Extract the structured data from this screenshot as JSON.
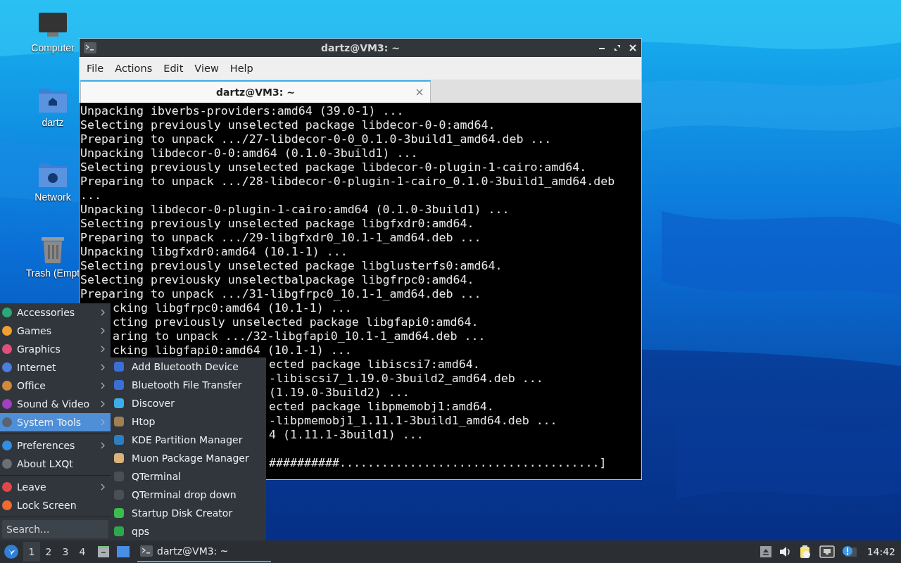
{
  "desktop_icons": [
    {
      "label": "Computer"
    },
    {
      "label": "dartz"
    },
    {
      "label": "Network"
    },
    {
      "label": "Trash (Empt"
    }
  ],
  "window": {
    "title": "dartz@VM3: ~",
    "menu": [
      "File",
      "Actions",
      "Edit",
      "View",
      "Help"
    ],
    "tabs": [
      {
        "label": "dartz@VM3: ~",
        "selected": true
      }
    ],
    "terminal_lines": [
      {
        "kind": "full",
        "text": "Unpacking ibverbs-providers:amd64 (39.0-1) ..."
      },
      {
        "kind": "full",
        "text": "Selecting previously unselected package libdecor-0-0:amd64."
      },
      {
        "kind": "full",
        "text": "Preparing to unpack .../27-libdecor-0-0_0.1.0-3build1_amd64.deb ..."
      },
      {
        "kind": "full",
        "text": "Unpacking libdecor-0-0:amd64 (0.1.0-3build1) ..."
      },
      {
        "kind": "full",
        "text": "Selecting previously unselected package libdecor-0-plugin-1-cairo:amd64."
      },
      {
        "kind": "full",
        "text": "Preparing to unpack .../28-libdecor-0-plugin-1-cairo_0.1.0-3build1_amd64.deb"
      },
      {
        "kind": "full",
        "text": "..."
      },
      {
        "kind": "full",
        "text": "Unpacking libdecor-0-plugin-1-cairo:amd64 (0.1.0-3build1) ..."
      },
      {
        "kind": "full",
        "text": "Selecting previously unselected package libgfxdr0:amd64."
      },
      {
        "kind": "full",
        "text": "Preparing to unpack .../29-libgfxdr0_10.1-1_amd64.deb ..."
      },
      {
        "kind": "full",
        "text": "Unpacking libgfxdr0:amd64 (10.1-1) ..."
      },
      {
        "kind": "full",
        "text": "Selecting previously unselected package libglusterfs0:amd64."
      },
      {
        "kind": "full",
        "text": "Selecting previousky unselectbalpackage libgfrpc0:amd64."
      },
      {
        "kind": "full",
        "text": "Preparing to unpack .../31-libgfrpc0_10.1-1_amd64.deb ..."
      },
      {
        "kind": "under_menu",
        "text": "cking libgfrpc0:amd64 (10.1-1) ..."
      },
      {
        "kind": "under_menu",
        "text": "cting previously unselected package libgfapi0:amd64."
      },
      {
        "kind": "under_menu",
        "text": "aring to unpack .../32-libgfapi0_10.1-1_amd64.deb ..."
      },
      {
        "kind": "under_menu",
        "text": "cking libgfapi0:amd64 (10.1-1) ..."
      },
      {
        "kind": "under_submenu",
        "text": "ected package libiscsi7:amd64."
      },
      {
        "kind": "under_submenu",
        "text": "-libiscsi7_1.19.0-3build2_amd64.deb ..."
      },
      {
        "kind": "under_submenu",
        "text": "(1.19.0-3build2) ..."
      },
      {
        "kind": "under_submenu",
        "text": "ected package libpmemobj1:amd64."
      },
      {
        "kind": "under_submenu",
        "text": "-libpmemobj1_1.11.1-3build1_amd64.deb ..."
      },
      {
        "kind": "under_submenu",
        "text": "4 (1.11.1-3build1) ..."
      },
      {
        "kind": "blank"
      },
      {
        "kind": "under_submenu",
        "text": "##########.....................................]"
      }
    ]
  },
  "app_menu": {
    "groups": [
      {
        "items": [
          {
            "label": "Accessories",
            "has_submenu": true,
            "selected": false
          },
          {
            "label": "Games",
            "has_submenu": true,
            "selected": false
          },
          {
            "label": "Graphics",
            "has_submenu": true,
            "selected": false
          },
          {
            "label": "Internet",
            "has_submenu": true,
            "selected": false
          },
          {
            "label": "Office",
            "has_submenu": true,
            "selected": false
          },
          {
            "label": "Sound & Video",
            "has_submenu": true,
            "selected": false
          },
          {
            "label": "System Tools",
            "has_submenu": true,
            "selected": true
          }
        ]
      },
      {
        "items": [
          {
            "label": "Preferences",
            "has_submenu": true,
            "selected": false
          },
          {
            "label": "About LXQt",
            "has_submenu": false,
            "selected": false
          }
        ]
      },
      {
        "items": [
          {
            "label": "Leave",
            "has_submenu": true,
            "selected": false
          },
          {
            "label": "Lock Screen",
            "has_submenu": false,
            "selected": false
          }
        ]
      }
    ],
    "search": {
      "placeholder": "Search..."
    }
  },
  "submenu": {
    "items": [
      {
        "label": "Add Bluetooth Device"
      },
      {
        "label": "Bluetooth File Transfer"
      },
      {
        "label": "Discover"
      },
      {
        "label": "Htop"
      },
      {
        "label": "KDE Partition Manager"
      },
      {
        "label": "Muon Package Manager"
      },
      {
        "label": "QTerminal"
      },
      {
        "label": "QTerminal drop down"
      },
      {
        "label": "Startup Disk Creator"
      },
      {
        "label": "qps"
      }
    ]
  },
  "taskbar": {
    "desktops": [
      {
        "label": "1",
        "selected": true
      },
      {
        "label": "2",
        "selected": false
      },
      {
        "label": "3",
        "selected": false
      },
      {
        "label": "4",
        "selected": false
      }
    ],
    "tasks": [
      {
        "label": "dartz@VM3: ~",
        "selected": true
      }
    ],
    "clock": "14:42"
  }
}
